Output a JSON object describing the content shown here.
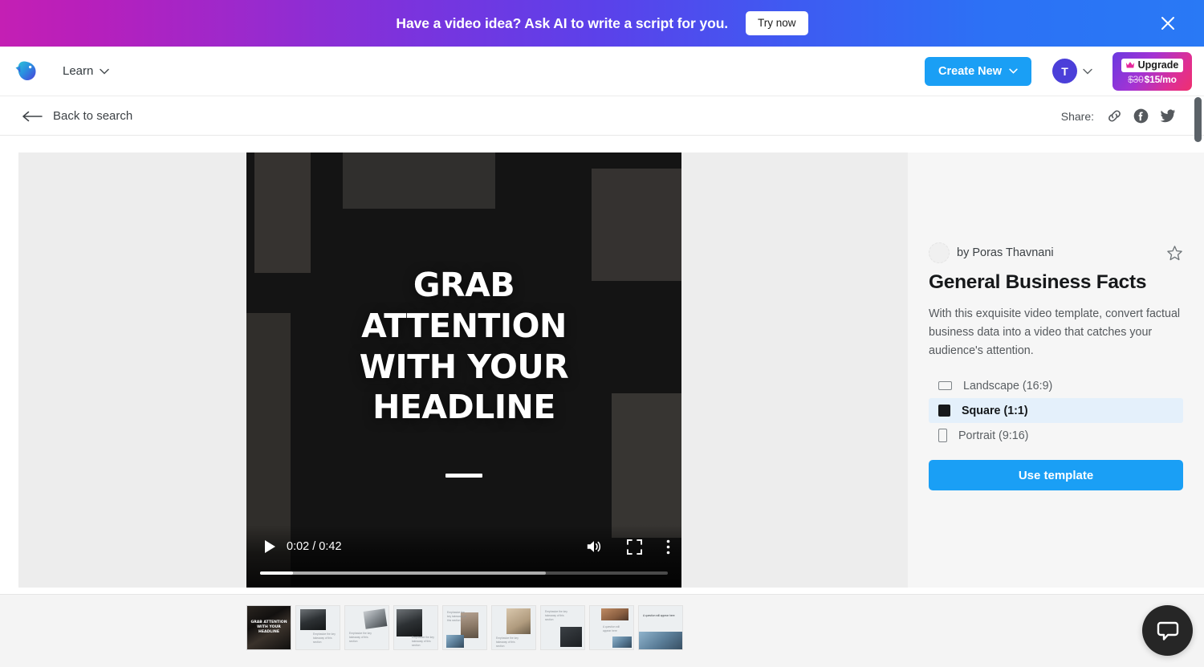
{
  "promo_banner": {
    "message": "Have a video idea? Ask AI to write a script for you.",
    "cta_label": "Try now",
    "close_icon": "close-x-icon",
    "gradient_start": "#c41fb4",
    "gradient_end": "#2979f5"
  },
  "header": {
    "logo_icon": "invideo-logo-icon",
    "nav": {
      "learn_label": "Learn",
      "chevron_icon": "chevron-down-icon"
    },
    "create_new": {
      "label": "Create New",
      "chevron_icon": "chevron-down-icon",
      "color": "#1a9ff5"
    },
    "account": {
      "avatar_initial": "T",
      "avatar_color": "#4b3fd9",
      "chevron_icon": "chevron-down-icon"
    },
    "upgrade": {
      "label": "Upgrade",
      "crown_icon": "crown-icon",
      "price_old": "$30",
      "price_new": "$15/mo",
      "gradient_start": "#6a3ae0",
      "gradient_end": "#ef2f6e"
    }
  },
  "sub_bar": {
    "back_label": "Back to search",
    "back_icon": "arrow-left-icon",
    "share_label": "Share:",
    "share_targets": [
      {
        "name": "copy-link",
        "icon": "link-icon"
      },
      {
        "name": "facebook",
        "icon": "facebook-icon"
      },
      {
        "name": "twitter",
        "icon": "twitter-icon"
      }
    ]
  },
  "player": {
    "overlay_lines": [
      "GRAB",
      "ATTENTION",
      "WITH YOUR",
      "HEADLINE"
    ],
    "current_time": "0:02",
    "duration": "0:42",
    "time_display": "0:02 / 0:42",
    "played_percent": 8,
    "buffered_percent": 70,
    "controls": [
      {
        "name": "play-button",
        "icon": "play-icon"
      },
      {
        "name": "mute-button",
        "icon": "volume-icon"
      },
      {
        "name": "fullscreen-button",
        "icon": "fullscreen-icon"
      },
      {
        "name": "more-options-button",
        "icon": "kebab-menu-icon"
      }
    ]
  },
  "info_panel": {
    "author_prefix": "by Poras Thavnani",
    "favorite_icon": "star-outline-icon",
    "title": "General Business Facts",
    "description": "With this exquisite video template, convert factual business data into a video that catches your audience's attention.",
    "aspect_ratios": [
      {
        "label": "Landscape (16:9)",
        "icon": "landscape-rect-icon",
        "selected": false
      },
      {
        "label": "Square (1:1)",
        "icon": "square-rect-icon",
        "selected": true
      },
      {
        "label": "Portrait (9:16)",
        "icon": "portrait-rect-icon",
        "selected": false
      }
    ],
    "use_template_label": "Use template",
    "selected_ratio": "Square (1:1)"
  },
  "thumbnails": {
    "count": 9,
    "active_index": 0,
    "items": [
      {
        "caption": "GRAB ATTENTION WITH YOUR HEADLINE",
        "kind": "dark-headline"
      },
      {
        "caption": "Emphasize the key takeaway of this section",
        "kind": "light-scene"
      },
      {
        "caption": "Emphasize the key takeaway of this section",
        "kind": "light-scene"
      },
      {
        "caption": "Emphasize the key takeaway of this section",
        "kind": "light-scene"
      },
      {
        "caption": "Emphasize the key takeaway of this section",
        "kind": "light-scene"
      },
      {
        "caption": "Emphasize the key takeaway of this section",
        "kind": "light-scene"
      },
      {
        "caption": "Emphasize the key takeaway of this section",
        "kind": "light-scene"
      },
      {
        "caption": "A question will appear here",
        "kind": "light-scene"
      },
      {
        "caption": "A question will appear here",
        "kind": "light-scene"
      }
    ]
  },
  "chat_widget": {
    "icon": "chat-bubble-icon",
    "color": "#262626"
  },
  "scrollbar": {
    "orientation": "vertical",
    "thumb_color": "#5b6268"
  }
}
